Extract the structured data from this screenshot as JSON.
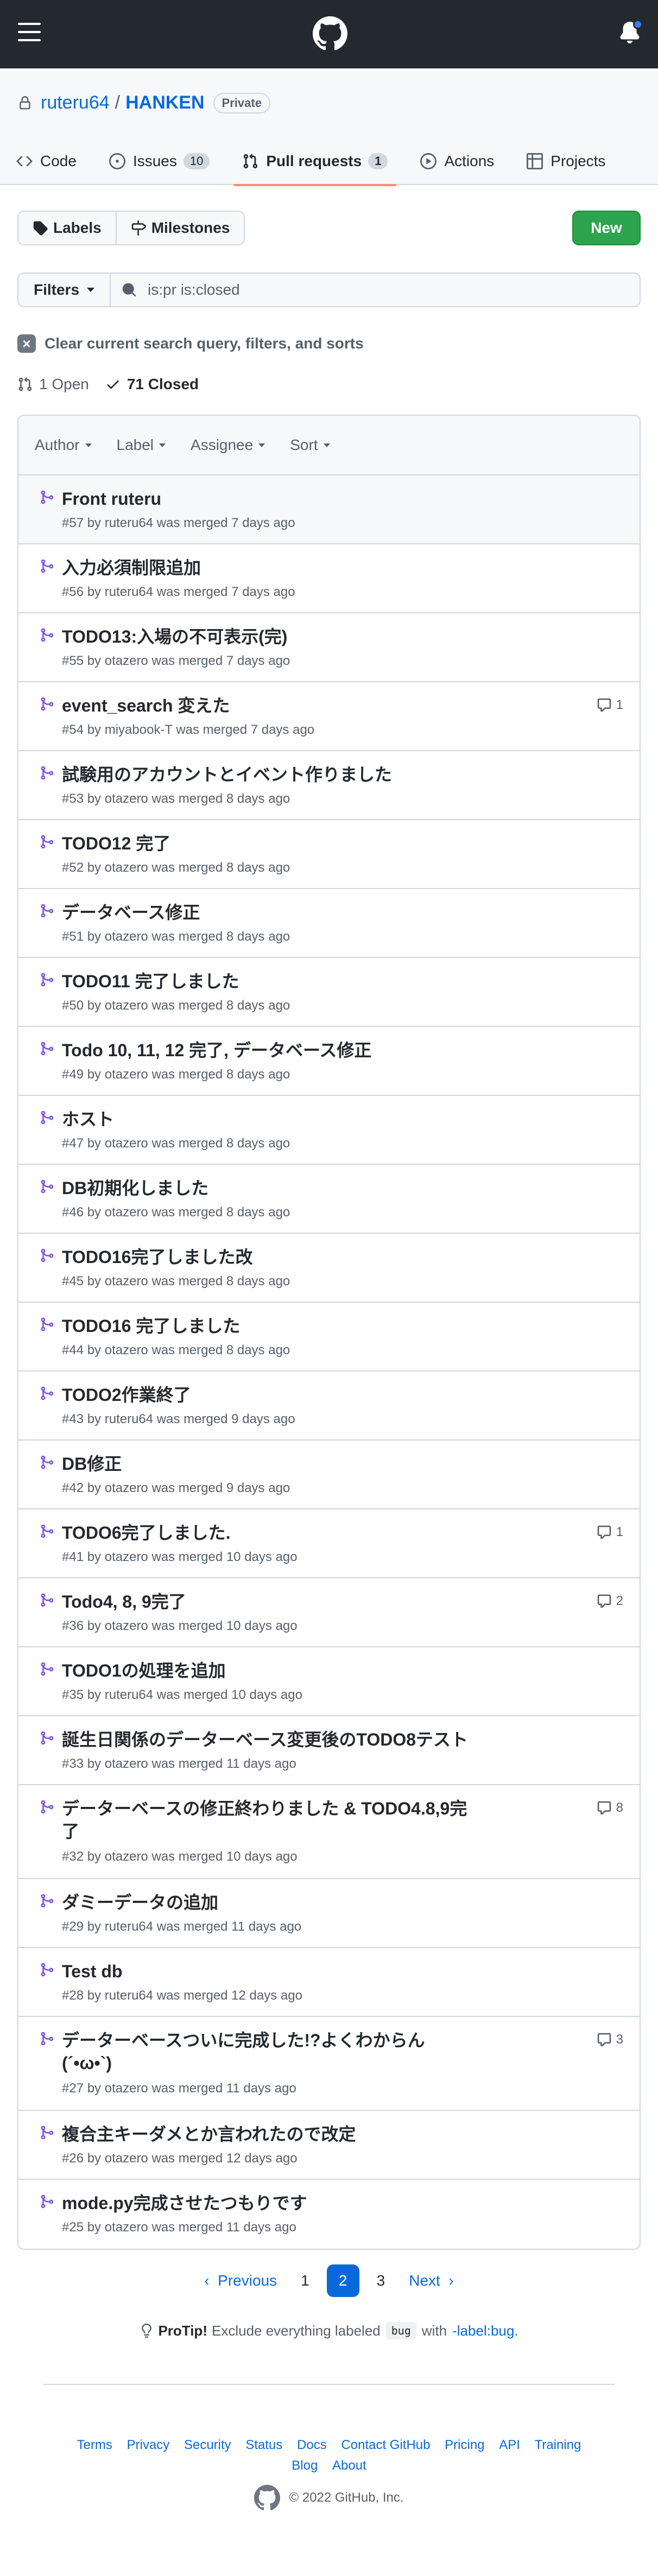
{
  "repo": {
    "owner": "ruteru64",
    "separator": "/",
    "name": "HANKEN",
    "visibility": "Private"
  },
  "tabs": [
    {
      "label": "Code",
      "icon": "code-icon"
    },
    {
      "label": "Issues",
      "count": "10",
      "icon": "issue-icon"
    },
    {
      "label": "Pull requests",
      "count": "1",
      "icon": "pull-request-icon"
    },
    {
      "label": "Actions",
      "icon": "play-icon"
    },
    {
      "label": "Projects",
      "icon": "table-icon"
    }
  ],
  "toolbar": {
    "labels": "Labels",
    "milestones": "Milestones",
    "new": "New"
  },
  "filter": {
    "button": "Filters",
    "query": "is:pr is:closed"
  },
  "clear": {
    "label": "Clear current search query, filters, and sorts"
  },
  "states": {
    "open": "1 Open",
    "closed": "71 Closed"
  },
  "list_header": {
    "author": "Author",
    "label": "Label",
    "assignee": "Assignee",
    "sort": "Sort"
  },
  "pulls": [
    {
      "title": "Front ruteru",
      "meta": "#57 by ruteru64 was merged 7 days ago",
      "comments": ""
    },
    {
      "title": "入力必須制限追加",
      "meta": "#56 by ruteru64 was merged 7 days ago",
      "comments": ""
    },
    {
      "title": "TODO13:入場の不可表示(完)",
      "meta": "#55 by otazero was merged 7 days ago",
      "comments": ""
    },
    {
      "title": "event_search 変えた",
      "meta": "#54 by miyabook-T was merged 7 days ago",
      "comments": "1"
    },
    {
      "title": "試験用のアカウントとイベント作りました",
      "meta": "#53 by otazero was merged 8 days ago",
      "comments": ""
    },
    {
      "title": "TODO12 完了",
      "meta": "#52 by otazero was merged 8 days ago",
      "comments": ""
    },
    {
      "title": "データベース修正",
      "meta": "#51 by otazero was merged 8 days ago",
      "comments": ""
    },
    {
      "title": "TODO11 完了しました",
      "meta": "#50 by otazero was merged 8 days ago",
      "comments": ""
    },
    {
      "title": "Todo 10, 11, 12 完了, データベース修正",
      "meta": "#49 by otazero was merged 8 days ago",
      "comments": ""
    },
    {
      "title": "ホスト",
      "meta": "#47 by otazero was merged 8 days ago",
      "comments": ""
    },
    {
      "title": "DB初期化しました",
      "meta": "#46 by otazero was merged 8 days ago",
      "comments": ""
    },
    {
      "title": "TODO16完了しました改",
      "meta": "#45 by otazero was merged 8 days ago",
      "comments": ""
    },
    {
      "title": "TODO16 完了しました",
      "meta": "#44 by otazero was merged 8 days ago",
      "comments": ""
    },
    {
      "title": "TODO2作業終了",
      "meta": "#43 by ruteru64 was merged 9 days ago",
      "comments": ""
    },
    {
      "title": "DB修正",
      "meta": "#42 by otazero was merged 9 days ago",
      "comments": ""
    },
    {
      "title": "TODO6完了しました.",
      "meta": "#41 by otazero was merged 10 days ago",
      "comments": "1"
    },
    {
      "title": "Todo4, 8, 9完了",
      "meta": "#36 by otazero was merged 10 days ago",
      "comments": "2"
    },
    {
      "title": "TODO1の処理を追加",
      "meta": "#35 by ruteru64 was merged 10 days ago",
      "comments": ""
    },
    {
      "title": "誕生日関係のデーターベース変更後のTODO8テスト",
      "meta": "#33 by otazero was merged 11 days ago",
      "comments": ""
    },
    {
      "title": "データーベースの修正終わりました & TODO4.8,9完了",
      "meta": "#32 by otazero was merged 10 days ago",
      "comments": "8"
    },
    {
      "title": "ダミーデータの追加",
      "meta": "#29 by ruteru64 was merged 11 days ago",
      "comments": ""
    },
    {
      "title": "Test db",
      "meta": "#28 by ruteru64 was merged 12 days ago",
      "comments": ""
    },
    {
      "title": "データーベースついに完成した!?よくわからん(´•ω•`)",
      "meta": "#27 by otazero was merged 11 days ago",
      "comments": "3"
    },
    {
      "title": "複合主キーダメとか言われたので改定",
      "meta": "#26 by otazero was merged 12 days ago",
      "comments": ""
    },
    {
      "title": "mode.py完成させたつもりです",
      "meta": "#25 by otazero was merged 11 days ago",
      "comments": ""
    }
  ],
  "pagination": {
    "previous": "Previous",
    "pages": [
      "1",
      "2",
      "3"
    ],
    "current": "2",
    "next": "Next"
  },
  "protip": {
    "prefix": "ProTip!",
    "text1": "Exclude everything labeled",
    "code": "bug",
    "text2": "with",
    "link": "-label:bug."
  },
  "footer": {
    "links": [
      "Terms",
      "Privacy",
      "Security",
      "Status",
      "Docs",
      "Contact GitHub",
      "Pricing",
      "API",
      "Training",
      "Blog",
      "About"
    ],
    "copyright": "© 2022 GitHub, Inc."
  },
  "colors": {
    "merged": "#8250df",
    "accent": "#0969da",
    "green": "#2da44e",
    "topbar": "#24292f"
  }
}
